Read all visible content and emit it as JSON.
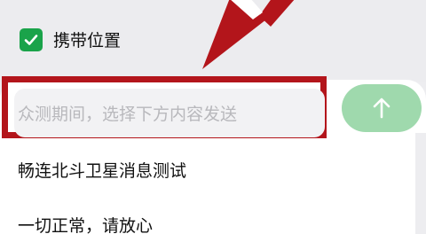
{
  "location": {
    "checked": true,
    "label": "携带位置"
  },
  "composer": {
    "placeholder": "众测期间，选择下方内容发送",
    "send_icon": "arrow-up-icon"
  },
  "messages": [
    {
      "text": "畅连北斗卫星消息测试"
    },
    {
      "text": "一切正常，请放心"
    }
  ],
  "colors": {
    "checkbox": "#1aa34a",
    "send_button": "#9fd9ad",
    "annotation": "#b3151b"
  }
}
